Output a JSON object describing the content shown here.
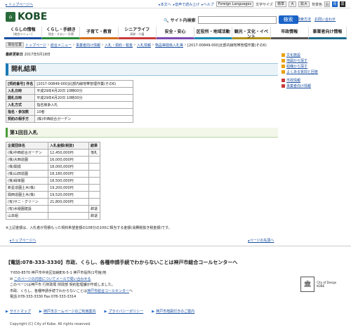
{
  "util": {
    "skip": "トップページへ",
    "honbun": "本文へ",
    "voice": "音声で読み上げ",
    "help": "ヘルプ",
    "foreign": "Foreign Languages",
    "text_size_label": "文字サイズ",
    "text_std": "標準",
    "text_big": "大",
    "text_bigger": "拡大",
    "bg_label": "背景色",
    "bg_white": "白",
    "bg_blue": "青",
    "bg_black": "黒"
  },
  "header": {
    "logo": "KOBE",
    "search_label": "サイト内検索",
    "search_placeholder": "",
    "search_button": "検索",
    "link_howto": "検索方法",
    "link_contact": "お問い合わせ"
  },
  "gnav": [
    {
      "main": "くらしの情報",
      "sub": "[総合メニュー]"
    },
    {
      "main": "くらし・手続き",
      "sub": "税金・すまい・住環"
    },
    {
      "main": "子育て・教育",
      "sub": ""
    },
    {
      "main": "シニアライフ",
      "sub": "高齢・介護"
    },
    {
      "main": "安全・安心",
      "sub": ""
    },
    {
      "main": "区役所・地域活動",
      "sub": ""
    },
    {
      "main": "観光・文化・イベント",
      "sub": ""
    },
    {
      "main": "市政情報",
      "sub": ""
    },
    {
      "main": "事業者向け情報",
      "sub": ""
    }
  ],
  "breadcrumb": {
    "here": "現在位置",
    "items": [
      "トップページ",
      "総合メニュー",
      "事業者向け情報",
      "入札・契約・税金",
      "入札情報",
      "物品等関係入札等"
    ],
    "current": "[2017-00849-000]北部内線地帯管理作業(その6)"
  },
  "updated": {
    "label": "最終更新日",
    "date": "2017年5月18日"
  },
  "title": "開札結果",
  "info_rows": [
    {
      "k": "[契約番号] 件名",
      "v": "[2017-00849-000]北部内線地帯管理作業(その6)"
    },
    {
      "k": "入札日時",
      "v": "平成29年4月20日 10時00分"
    },
    {
      "k": "開札日時",
      "v": "平成29年4月20日 10時30分"
    },
    {
      "k": "入札方式",
      "v": "指名競争入札"
    },
    {
      "k": "指名・参加数",
      "v": "10者"
    },
    {
      "k": "契約の相手方",
      "v": "(株)中西総合ガーデン"
    }
  ],
  "round_title": "第1回目入札",
  "bid_header": {
    "name": "企業団体名",
    "amount": "入札金額(税抜)",
    "result": "結果"
  },
  "bid_rows": [
    {
      "name": "(株)中西総合ガーデン",
      "amount": "12,450,000円",
      "result": "落札"
    },
    {
      "name": "(株)大西造園",
      "amount": "16,000,000円",
      "result": ""
    },
    {
      "name": "(株)関成",
      "amount": "18,000,000円",
      "result": ""
    },
    {
      "name": "(株)山田造園",
      "amount": "18,180,000円",
      "result": ""
    },
    {
      "name": "(株)緑幸園",
      "amount": "18,500,000円",
      "result": ""
    },
    {
      "name": "新星造園土木(株)",
      "amount": "19,200,000円",
      "result": ""
    },
    {
      "name": "関西造園土木(株)",
      "amount": "19,520,000円",
      "result": ""
    },
    {
      "name": "(有)サニ・グリーン",
      "amount": "21,800,000円",
      "result": ""
    },
    {
      "name": "(有)水稲園建設",
      "amount": "",
      "result": "辞退"
    },
    {
      "name": "山本組",
      "amount": "",
      "result": "辞退"
    }
  ],
  "note": "※上記金額は、入札者が見積もった契約希望金額の108分の100に相当する金額(消費税抜き税金額)です。",
  "sidebar": [
    {
      "label": "文化施設",
      "color": "#e8a00a"
    },
    {
      "label": "地図から探す",
      "color": "#e8a00a"
    },
    {
      "label": "組織から探す",
      "color": "#e8a00a"
    },
    {
      "label": "よくある質問と回答",
      "color": "#e8a00a"
    },
    {
      "label": "市政情報",
      "color": "#c83a3a"
    },
    {
      "label": "事業者向け情報",
      "color": "#c83a3a"
    }
  ],
  "pagenav": {
    "to_top": "トップページへ",
    "page_top": "ページの先頭へ"
  },
  "footer": {
    "call": "【電話:078-333-3330】市政、くらし、各種申請手続でわからないことは神戸市総合コールセンターへ",
    "addr1": "〒650-8570 神戸市中央区加納町6-5-1 神戸市役所(1号館)地",
    "addr2": "このページの内容についてメールで問い合わせる",
    "addr3": "このページは神戸市 行財政局 財政部 契約監理課が作成しました。",
    "addr4": "市政、くらし、各種申請手続でわからないことは",
    "addr4_link": "神戸市総合コールセンター",
    "addr4_end": "へ",
    "tel": "電話:078-333-3330 Fax:078-333-3314",
    "unesco": "City of Design KOBE",
    "links": [
      "サイトマップ",
      "神戸市ホームページのご利用案内",
      "プライバシーポリシー",
      "神戸市地図付きのご案内"
    ],
    "copyright": "Copyright (C) City of Kobe. All rights reserved."
  }
}
